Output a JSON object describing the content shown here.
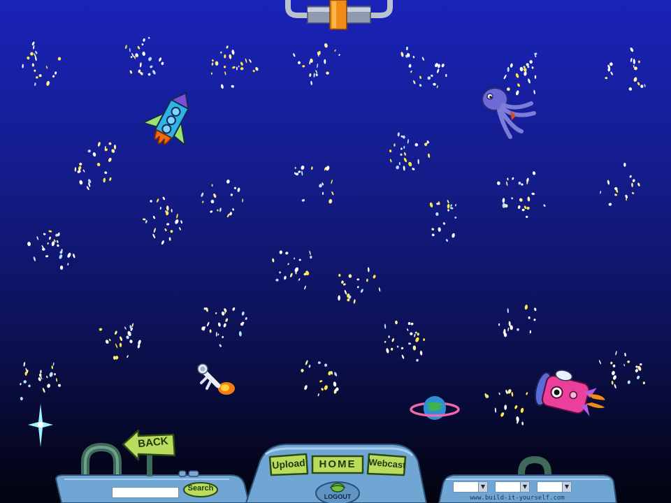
{
  "nav": {
    "back_label": "BACK",
    "upload_label": "Upload",
    "home_label": "HOME",
    "webcast_label": "Webcast",
    "logout_label": "LOGOUT",
    "search_label": "Search",
    "search_value": "",
    "site_url": "www.build-it-yourself.com"
  },
  "dropdowns": [
    {
      "selected": ""
    },
    {
      "selected": ""
    },
    {
      "selected": ""
    }
  ],
  "icons": {
    "rocket": "blue-rocket-icon",
    "squid": "purple-squid-icon",
    "astronaut": "astronaut-icon",
    "planet": "ringed-planet-icon",
    "pink_ship": "pink-spaceship-icon",
    "star": "sparkle-star-icon"
  },
  "colors": {
    "space_top": "#1a23b8",
    "space_bottom": "#02030f",
    "console": "#6fa6d4",
    "button_green": "#b9dc5e",
    "handle_orange": "#f08c16"
  }
}
